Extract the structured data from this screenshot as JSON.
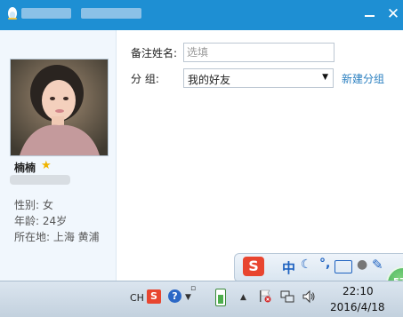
{
  "window": {
    "buttons": {
      "minimize": "minimize",
      "close": "✕"
    }
  },
  "profile": {
    "nickname": "楠楠",
    "gender": "性别: 女",
    "age": "年龄: 24岁",
    "location": "所在地: 上海  黄浦"
  },
  "form": {
    "remark_label": "备注姓名:",
    "remark_placeholder": "选填",
    "remark_value": "",
    "group_label": "分    组:",
    "group_value": "我的好友",
    "new_group_link": "新建分组"
  },
  "ime_toolbar": {
    "logo": "S",
    "mode": "中",
    "punctuation": "°,",
    "icons": [
      "sogou-logo-icon",
      "moon-icon",
      "keyboard-icon",
      "user-icon",
      "wrench-icon"
    ]
  },
  "floating_ball": {
    "value": "57"
  },
  "taskbar": {
    "language": "CH",
    "sogou": "S",
    "help": "?",
    "time": "22:10",
    "date": "2016/4/18",
    "icons": [
      "battery-icon",
      "show-hidden-icon",
      "action-center-flag-icon",
      "network-icon",
      "volume-icon"
    ]
  },
  "colors": {
    "titlebar": "#1e8fd3",
    "left_panel": "#f1f7fd",
    "link": "#2a7fc0",
    "ime_blue": "#1e62c0",
    "sogou_red": "#e8452f"
  }
}
